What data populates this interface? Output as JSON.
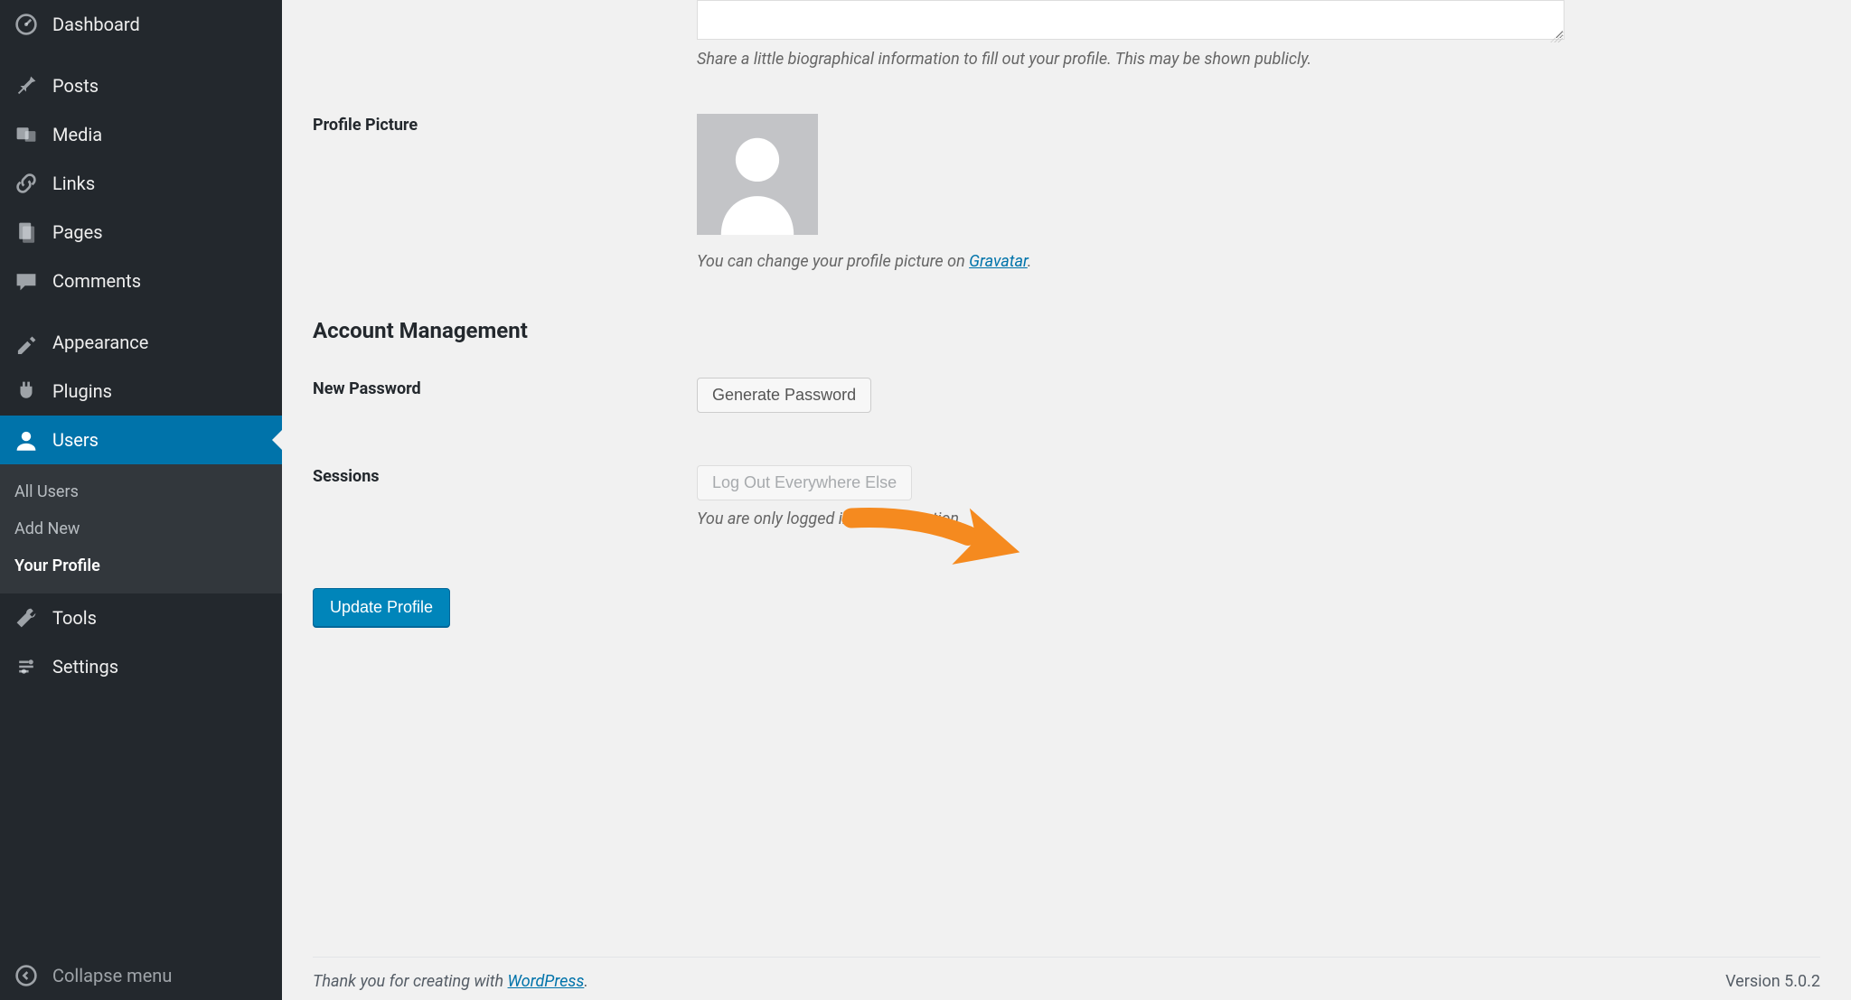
{
  "sidebar": {
    "items": [
      {
        "label": "Dashboard",
        "icon": "dashboard-icon"
      },
      {
        "label": "Posts",
        "icon": "pin-icon"
      },
      {
        "label": "Media",
        "icon": "media-icon"
      },
      {
        "label": "Links",
        "icon": "link-icon"
      },
      {
        "label": "Pages",
        "icon": "pages-icon"
      },
      {
        "label": "Comments",
        "icon": "comments-icon"
      },
      {
        "label": "Appearance",
        "icon": "appearance-icon"
      },
      {
        "label": "Plugins",
        "icon": "plugins-icon"
      },
      {
        "label": "Users",
        "icon": "users-icon"
      },
      {
        "label": "Tools",
        "icon": "tools-icon"
      },
      {
        "label": "Settings",
        "icon": "settings-icon"
      }
    ],
    "submenu": [
      {
        "label": "All Users"
      },
      {
        "label": "Add New"
      },
      {
        "label": "Your Profile"
      }
    ],
    "collapse_label": "Collapse menu"
  },
  "profile": {
    "bio_description": "Share a little biographical information to fill out your profile. This may be shown publicly.",
    "picture_label": "Profile Picture",
    "picture_desc_prefix": "You can change your profile picture on ",
    "picture_desc_link": "Gravatar",
    "picture_desc_suffix": "."
  },
  "account": {
    "section_title": "Account Management",
    "new_password_label": "New Password",
    "generate_password_button": "Generate Password",
    "sessions_label": "Sessions",
    "logout_button": "Log Out Everywhere Else",
    "sessions_desc": "You are only logged in at this location.",
    "update_button": "Update Profile"
  },
  "footer": {
    "thankyou_prefix": "Thank you for creating with ",
    "thankyou_link": "WordPress",
    "thankyou_suffix": ".",
    "version": "Version 5.0.2"
  }
}
